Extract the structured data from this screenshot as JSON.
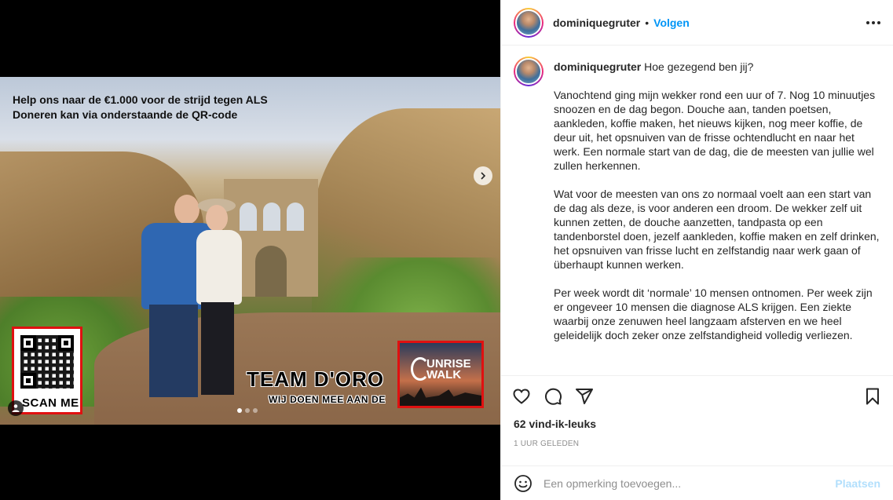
{
  "media": {
    "overlay_line_1": "Help ons naar de €1.000 voor de strijd tegen ALS",
    "overlay_line_2": "Doneren kan via onderstaande de QR-code",
    "scan_label": "SCAN ME",
    "team_title": "TEAM D'ORO",
    "team_subtitle": "WIJ DOEN MEE AAN DE",
    "logo_text_1": "UNRISE",
    "logo_text_2": "WALK",
    "carousel": {
      "total": 3,
      "active_index": 1
    }
  },
  "header": {
    "username": "dominiquegruter",
    "bullet": "•",
    "follow_label": "Volgen"
  },
  "caption": {
    "username": "dominiquegruter",
    "first_line": "Hoe gezegend ben jij?",
    "paragraphs": [
      "Vanochtend ging mijn wekker rond een uur of 7. Nog 10 minuutjes snoozen en de dag begon. Douche aan, tanden poetsen, aankleden, koffie maken, het nieuws kijken, nog meer koffie, de deur uit, het opsnuiven van de frisse ochtendlucht en naar het werk. Een normale start van de dag, die de meesten van jullie wel zullen herkennen.",
      "Wat voor de meesten van ons zo normaal voelt aan een start van de dag als deze, is voor anderen een droom. De wekker zelf uit kunnen zetten, de douche aanzetten, tandpasta op een tandenborstel doen, jezelf aankleden, koffie maken en zelf drinken, het opsnuiven van frisse lucht en zelfstandig naar werk gaan of überhaupt kunnen werken.",
      "Per week wordt dit ‘normale’ 10 mensen ontnomen. Per week zijn er ongeveer 10 mensen die diagnose ALS krijgen. Een ziekte waarbij onze zenuwen heel langzaam afsterven en we heel geleidelijk doch zeker onze zelfstandigheid volledig verliezen."
    ]
  },
  "stats": {
    "likes": "62 vind-ik-leuks",
    "time": "1 UUR GELEDEN"
  },
  "comment": {
    "placeholder": "Een opmerking toevoegen...",
    "value": "",
    "post_label": "Plaatsen"
  },
  "icons": {
    "like": "heart-icon",
    "comment": "comment-icon",
    "share": "share-icon",
    "save": "bookmark-icon",
    "emoji": "emoji-icon",
    "next": "chevron-right-icon",
    "tag": "user-tag-icon",
    "more": "more-icon"
  },
  "colors": {
    "accent": "#0095f6",
    "post_disabled": "#b2dffc",
    "muted": "#8e8e8e",
    "text": "#262626"
  }
}
